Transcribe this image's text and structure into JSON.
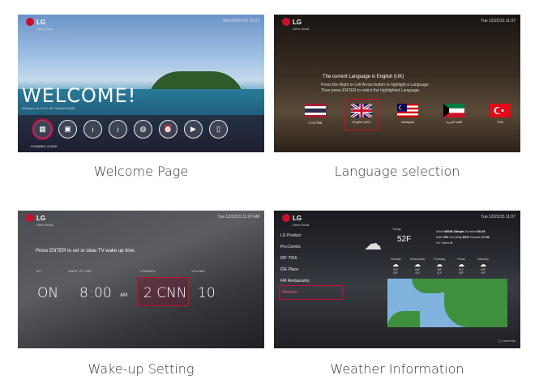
{
  "colors": {
    "accent": "#c8102e"
  },
  "welcome": {
    "logo": "LG",
    "logo_sub": "Life's Good",
    "datetime": "Wed 09/02/16 15:22",
    "title": "WELCOME!",
    "subtitle": "Welcome to LG H. Mr. Richard Smith",
    "icons": [
      "calendar-icon",
      "gift-icon",
      "info-icon",
      "info-icon",
      "globe-icon",
      "alarm-icon",
      "tv-icon",
      "phone-icon"
    ],
    "selected_label": "CHANNEL GUIDE",
    "caption": "Welcome Page"
  },
  "language": {
    "logo": "LG",
    "logo_sub": "Life's Good",
    "datetime": "Tue 12/22/15 11:07",
    "line1": "The current Language is English (UK)",
    "line2": "Press the Right or Left Arrow button to highlight a Language.",
    "line3": "Then press ENTER to select the highlighted Language.",
    "flags": [
      {
        "label": "ภาษาไทย"
      },
      {
        "label": "English (UK)"
      },
      {
        "label": "Malaysia"
      },
      {
        "label": "اللغة العربية"
      },
      {
        "label": "Türk"
      }
    ],
    "caption": "Language selection"
  },
  "wakeup": {
    "logo": "LG",
    "logo_sub": "Life's Good",
    "datetime": "Tue 12/22/15 11:07 AM",
    "message": "Press ENTER to set or clear TV wake up time.",
    "labels": {
      "set": "SET",
      "time": "WAKE UP TIME",
      "channel": "CHANNEL",
      "volume": "VOLUME"
    },
    "values": {
      "set": "ON",
      "hour": "8",
      "min": "00",
      "ampm": "AM",
      "channel": "2 CNN",
      "volume": "10"
    },
    "caption": "Wake-up Setting"
  },
  "weather": {
    "logo": "LG",
    "logo_sub": "Life's Good",
    "datetime": "Tue 12/22/15 11:07",
    "menu": [
      "LG Product",
      "Pro:Centric",
      "IDF 7916",
      "IDE Place",
      "FM Restaurants",
      "Weather"
    ],
    "today_label": "Today",
    "temp": "52F",
    "wind_label": "Wind",
    "wind": "WSW 23mph",
    "sunrise_label": "Sunrise",
    "sunrise": "08:15",
    "rain_label": "Rain",
    "rain": "0%",
    "humidity_label": "Humidity",
    "humidity": "81%",
    "sunset_label": "Sunset",
    "sunset": "17:32",
    "uv_label": "UV Index",
    "uv": "0",
    "forecast": [
      {
        "day": "Tuesday",
        "hi": "52F",
        "lo": "44F"
      },
      {
        "day": "Wednesday",
        "hi": "50F",
        "lo": "43F"
      },
      {
        "day": "Thursday",
        "hi": "48F",
        "lo": "41F"
      },
      {
        "day": "Friday",
        "hi": "51F",
        "lo": "45F"
      },
      {
        "day": "Saturday",
        "hi": "49F",
        "lo": "44F"
      }
    ],
    "footer": "◯ more info",
    "caption": "Weather Information"
  }
}
